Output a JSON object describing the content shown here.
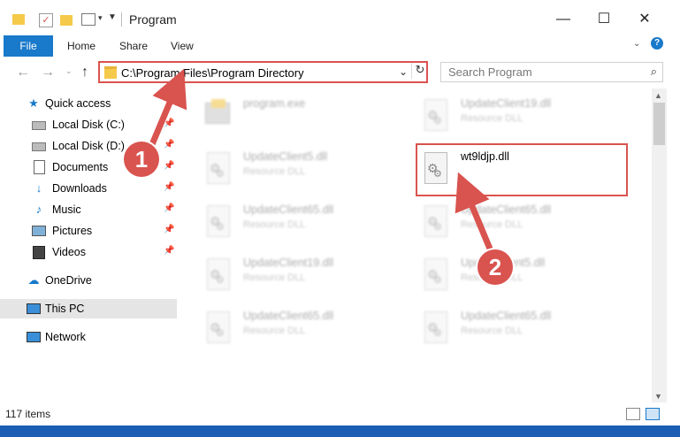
{
  "window": {
    "title": "Program",
    "minimize": "—",
    "maximize": "☐",
    "close": "✕"
  },
  "ribbon": {
    "file": "File",
    "tabs": [
      "Home",
      "Share",
      "View"
    ],
    "help": "?"
  },
  "address": {
    "path": "C:\\Program Files\\Program Directory",
    "search_placeholder": "Search Program"
  },
  "sidebar": {
    "quick_access": "Quick access",
    "items": [
      {
        "label": "Local Disk (C:)",
        "icon": "drive-icon"
      },
      {
        "label": "Local Disk (D:)",
        "icon": "drive-icon"
      },
      {
        "label": "Documents",
        "icon": "documents-icon"
      },
      {
        "label": "Downloads",
        "icon": "downloads-icon"
      },
      {
        "label": "Music",
        "icon": "music-icon"
      },
      {
        "label": "Pictures",
        "icon": "pictures-icon"
      },
      {
        "label": "Videos",
        "icon": "videos-icon"
      }
    ],
    "onedrive": "OneDrive",
    "this_pc": "This PC",
    "network": "Network"
  },
  "files": [
    {
      "name": "program.exe",
      "desc": ""
    },
    {
      "name": "UpdateClient19.dll",
      "desc": "Resource DLL"
    },
    {
      "name": "UpdateClient5.dll",
      "desc": "Resource DLL"
    },
    {
      "name": "wt9ldjp.dll",
      "desc": ""
    },
    {
      "name": "UpdateClient65.dll",
      "desc": "Resource DLL"
    },
    {
      "name": "UpdateClient65.dll",
      "desc": "Resource DLL"
    },
    {
      "name": "UpdateClient19.dll",
      "desc": "Resource DLL"
    },
    {
      "name": "UpdateClient5.dll",
      "desc": "Resource DLL"
    },
    {
      "name": "UpdateClient65.dll",
      "desc": "Resource DLL"
    },
    {
      "name": "UpdateClient65.dll",
      "desc": "Resource DLL"
    }
  ],
  "callouts": [
    "1",
    "2"
  ],
  "status": {
    "count": "117 items"
  },
  "colors": {
    "accent": "#1979ca",
    "highlight": "#d9534f"
  }
}
